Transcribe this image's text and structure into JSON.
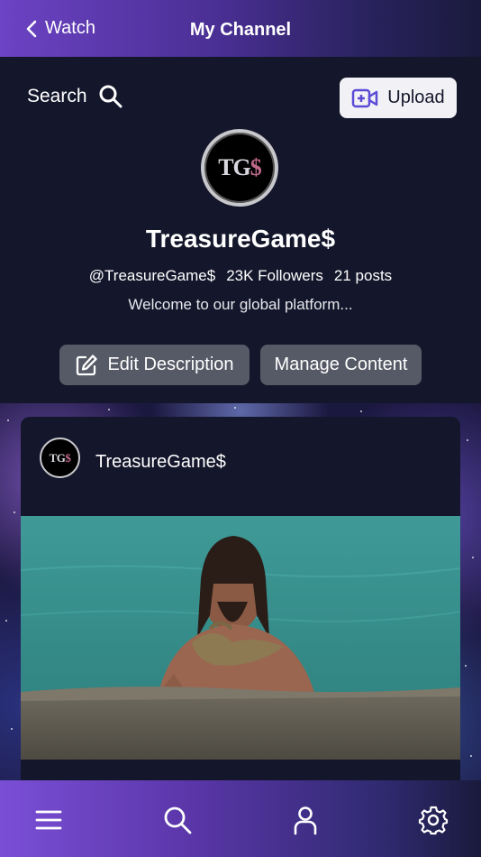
{
  "topbar": {
    "back_label": "Watch",
    "title": "My Channel"
  },
  "header": {
    "search_label": "Search",
    "upload_label": "Upload",
    "avatar_text_a": "TG",
    "avatar_text_b": "$",
    "channel_name": "TreasureGame$",
    "handle": "@TreasureGame$",
    "followers": "23K Followers",
    "posts": "21 posts",
    "description": "Welcome to our global platform...",
    "edit_button": "Edit Description",
    "manage_button": "Manage Content"
  },
  "post": {
    "author": "TreasureGame$",
    "avatar_text_a": "TG",
    "avatar_text_b": "$"
  },
  "nav": {
    "items": [
      "menu-icon",
      "search-icon",
      "profile-icon",
      "settings-icon"
    ]
  },
  "colors": {
    "bg": "#14162b",
    "accent": "#6c43c4",
    "upload_icon": "#5b4bd6",
    "button": "#565a66"
  }
}
